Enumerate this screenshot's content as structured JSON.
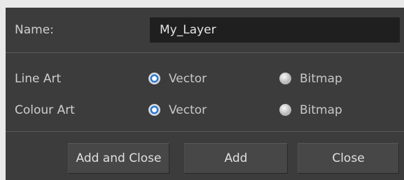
{
  "form": {
    "name_label": "Name:",
    "name_value": "My_Layer"
  },
  "line_art": {
    "label": "Line Art",
    "options": [
      {
        "label": "Vector",
        "selected": true
      },
      {
        "label": "Bitmap",
        "selected": false
      }
    ]
  },
  "colour_art": {
    "label": "Colour Art",
    "options": [
      {
        "label": "Vector",
        "selected": true
      },
      {
        "label": "Bitmap",
        "selected": false
      }
    ]
  },
  "buttons": {
    "add_and_close": "Add and Close",
    "add": "Add",
    "close": "Close"
  },
  "colors": {
    "panel": "#3c3c3c",
    "input_bg": "#1f1f1f",
    "button_bg": "#474747",
    "radio_selected": "#3a86de"
  }
}
